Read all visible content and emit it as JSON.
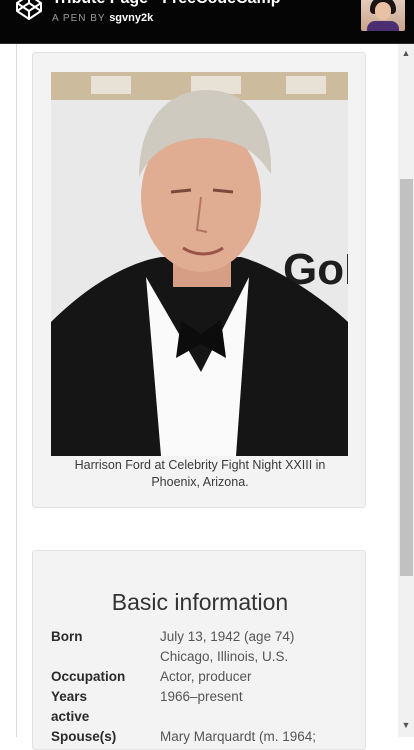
{
  "header": {
    "title": "Tribute Page - FreeCodeCamp",
    "byline_prefix": "A PEN BY",
    "author": "sgvny2k"
  },
  "figure": {
    "caption": "Harrison Ford at Celebrity Fight Night XXIII in Phoenix, Arizona."
  },
  "info": {
    "heading": "Basic information",
    "rows": [
      {
        "label": "Born",
        "value_lines": [
          "July 13, 1942 (age 74)",
          "Chicago, Illinois, U.S."
        ]
      },
      {
        "label": "Occupation",
        "value_lines": [
          "Actor, producer"
        ]
      },
      {
        "label_lines": [
          "Years",
          "active"
        ],
        "value_lines": [
          "1966–present"
        ]
      },
      {
        "label": "Spouse(s)",
        "value_lines": [
          "Mary Marquardt (m. 1964;"
        ]
      }
    ]
  },
  "scrollbar": {
    "up": "▲",
    "down": "▼"
  },
  "colors": {
    "topbar": "#050505",
    "card": "#f3f3f3",
    "scrollbar_thumb": "#c1c1c1"
  },
  "icons": [
    "codepen-logo-icon",
    "user-avatar",
    "scroll-up-arrow-icon",
    "scroll-down-arrow-icon"
  ]
}
